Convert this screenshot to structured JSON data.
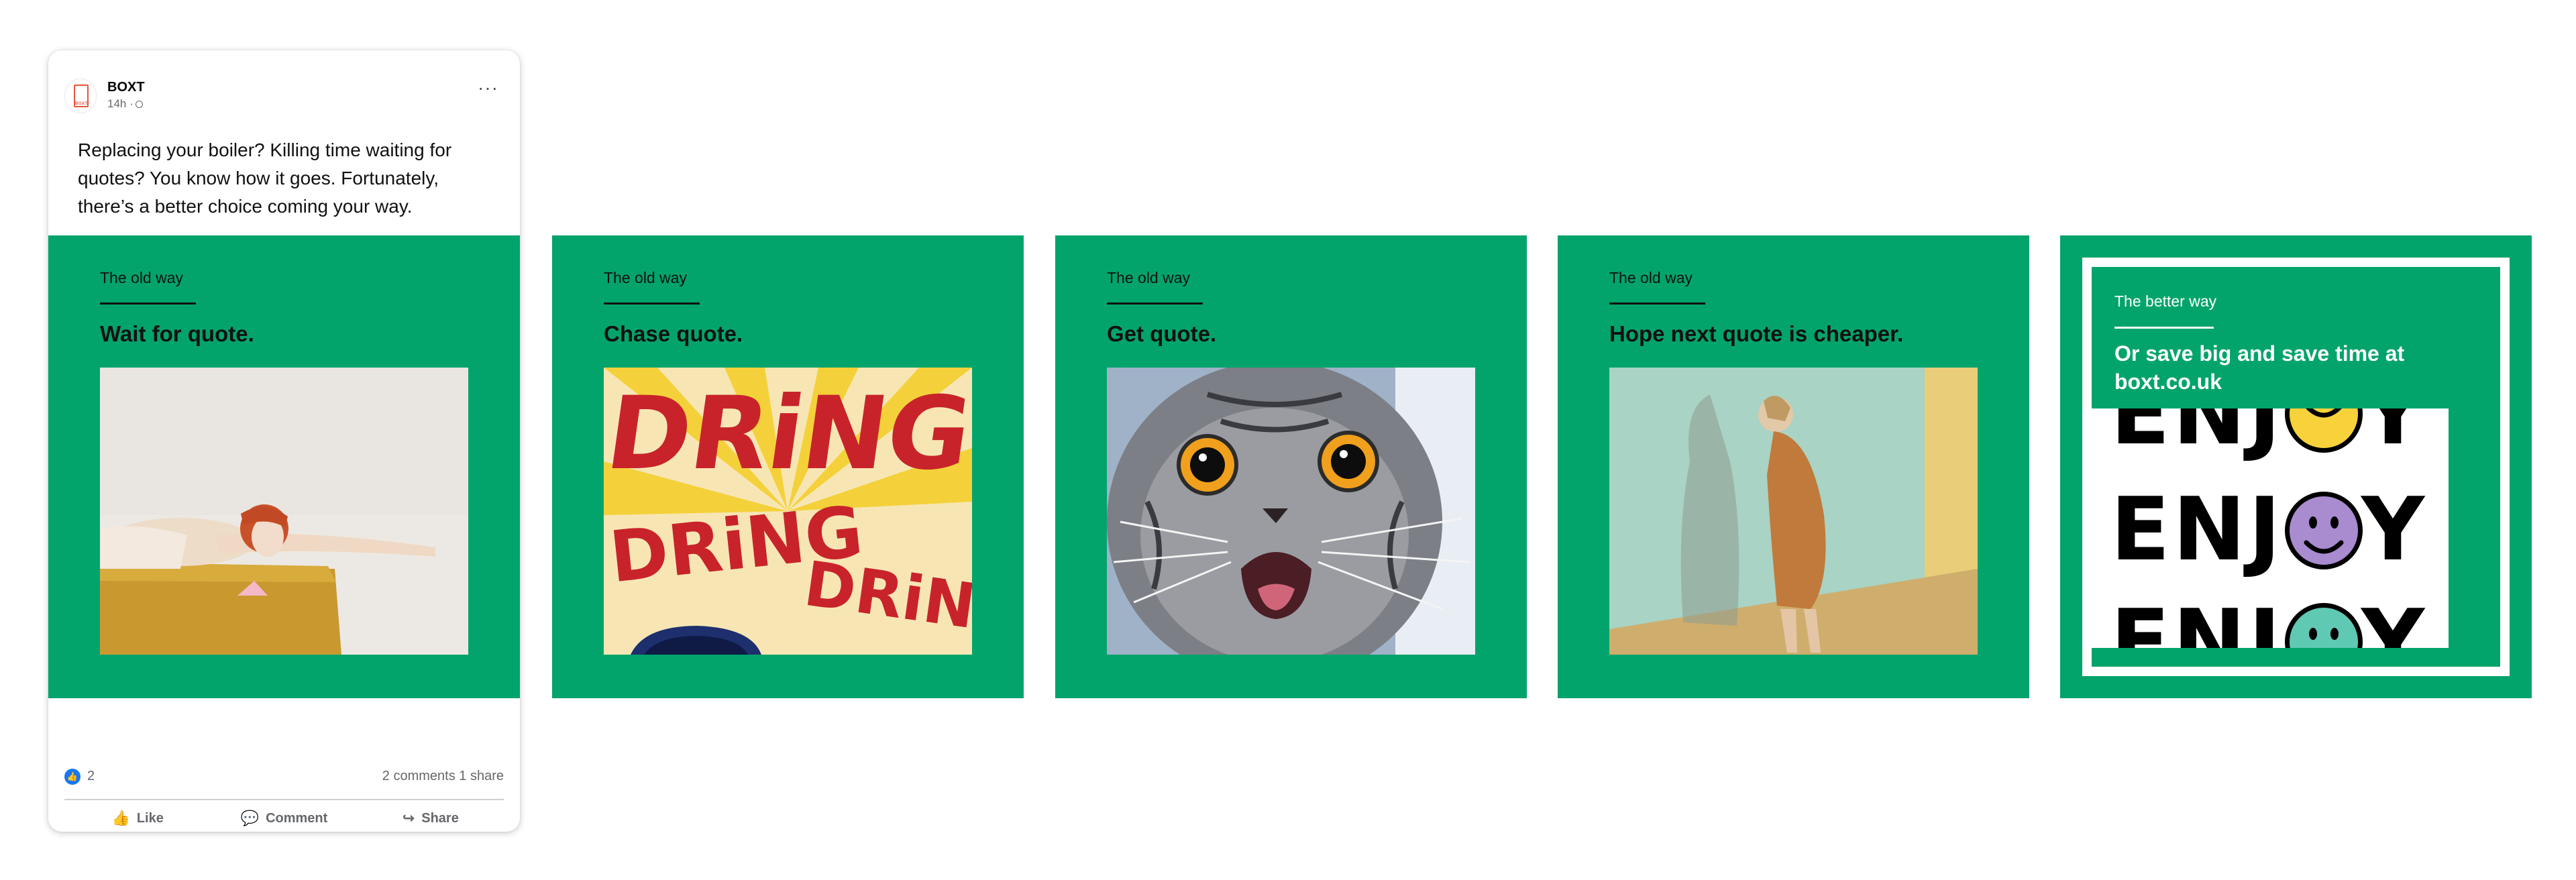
{
  "post": {
    "page_name": "BOXT",
    "time": "14h ·",
    "avatar_text": "BOXT",
    "more_label": "···",
    "text": "Replacing your boiler? Killing time waiting for quotes? You know how it goes. Fortunately, there’s a better choice coming your way.",
    "reaction_count": "2",
    "engagement": "2 comments  1 share",
    "actions": {
      "like": "Like",
      "comment": "Comment",
      "share": "Share"
    }
  },
  "panels": [
    {
      "eyebrow": "The old way",
      "headline": "Wait for quote.",
      "image": "woman lying on sofa"
    },
    {
      "eyebrow": "The old way",
      "headline": "Chase quote.",
      "image": "DRING DRING DRING comic",
      "comic_words": [
        "DRiNG",
        "DRiNG",
        "DRiNG"
      ]
    },
    {
      "eyebrow": "The old way",
      "headline": "Get quote.",
      "image": "shocked cat"
    },
    {
      "eyebrow": "The old way",
      "headline": "Hope next quote is cheaper.",
      "image": "woman leaning on wall"
    },
    {
      "eyebrow": "The better way",
      "headline": "Or save big and save time at boxt.co.uk",
      "enjoy_word": "ENJ",
      "enjoy_tail": "Y"
    }
  ],
  "colors": {
    "brand_green": "#02a46b",
    "facebook_blue": "#1877f2",
    "smiley_yellow": "#f7d23a",
    "smiley_purple": "#a98bd0",
    "smiley_teal": "#5fc9b4"
  }
}
